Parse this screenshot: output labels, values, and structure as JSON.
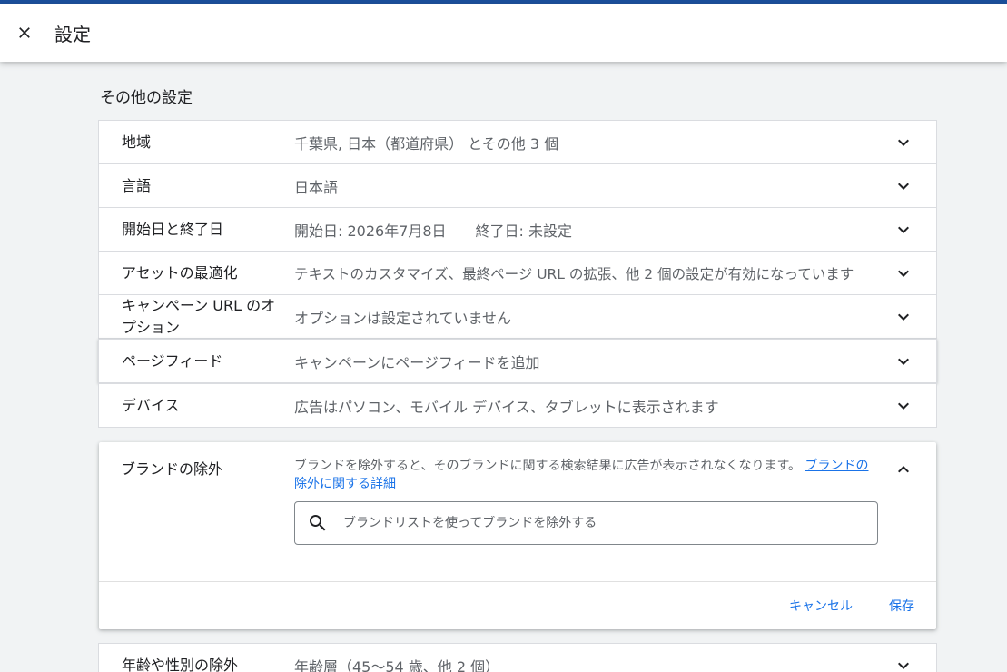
{
  "header": {
    "title": "設定"
  },
  "section": {
    "title": "その他の設定"
  },
  "rows": [
    {
      "label": "地域",
      "value": "千葉県, 日本（都道府県） とその他 3 個"
    },
    {
      "label": "言語",
      "value": "日本語"
    },
    {
      "label": "開始日と終了日",
      "value": "開始日: 2026年7月8日　　終了日: 未設定"
    },
    {
      "label": "アセットの最適化",
      "value": "テキストのカスタマイズ、最終ページ URL の拡張、他 2 個の設定が有効になっています"
    },
    {
      "label": "キャンペーン URL のオプション",
      "value": "オプションは設定されていません"
    },
    {
      "label": "ページフィード",
      "value": "キャンペーンにページフィードを追加"
    },
    {
      "label": "デバイス",
      "value": "広告はパソコン、モバイル デバイス、タブレットに表示されます"
    }
  ],
  "brand": {
    "label": "ブランドの除外",
    "description": "ブランドを除外すると、そのブランドに関する検索結果に広告が表示されなくなります。",
    "link": "ブランドの除外に関する詳細",
    "search_placeholder": "ブランドリストを使ってブランドを除外する",
    "cancel": "キャンセル",
    "save": "保存"
  },
  "age_row": {
    "label": "年齢や性別の除外",
    "value": "年齢層（45〜54 歳、他 2 個）"
  },
  "colors": {
    "accent": "#1a73e8",
    "top_stripe": "#1a4f9c"
  }
}
